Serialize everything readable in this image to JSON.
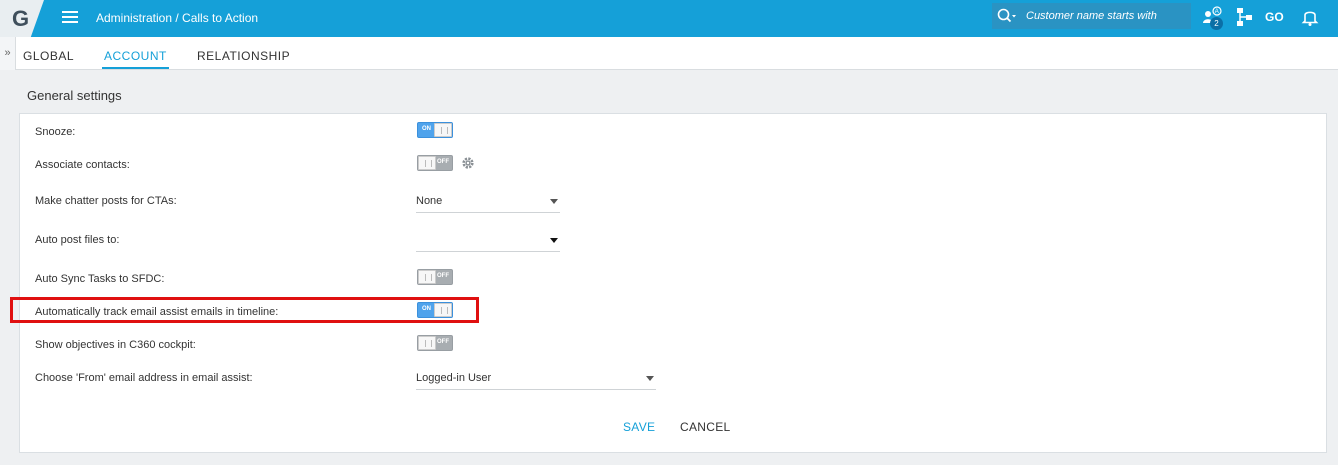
{
  "app": {
    "logo_letter": "G",
    "breadcrumb": "Administration / Calls to Action",
    "search_placeholder": "Customer name starts with",
    "notification_count": "2",
    "go_label": "GO"
  },
  "tabs": [
    {
      "label": "GLOBAL",
      "active": false
    },
    {
      "label": "ACCOUNT",
      "active": true
    },
    {
      "label": "RELATIONSHIP",
      "active": false
    }
  ],
  "section": {
    "title": "General settings"
  },
  "settings": [
    {
      "label": "Snooze:",
      "control": "toggle",
      "state": "ON"
    },
    {
      "label": "Associate contacts:",
      "control": "toggle",
      "state": "OFF"
    },
    {
      "label": "Make chatter posts for CTAs:",
      "control": "select",
      "value": "None"
    },
    {
      "label": "Auto post files to:",
      "control": "select",
      "value": ""
    },
    {
      "label": "Auto Sync Tasks to SFDC:",
      "control": "toggle",
      "state": "OFF"
    },
    {
      "label": "Automatically track email assist emails in timeline:",
      "control": "toggle",
      "state": "ON"
    },
    {
      "label": "Show objectives in C360 cockpit:",
      "control": "toggle",
      "state": "OFF"
    },
    {
      "label": "Choose 'From' email address in email assist:",
      "control": "select",
      "value": "Logged-in User"
    }
  ],
  "actions": {
    "save": "SAVE",
    "cancel": "CANCEL"
  },
  "colors": {
    "accent": "#15a0d8",
    "highlight": "#e01010",
    "toggle_on": "#4fa3ec",
    "toggle_off": "#a8adb1"
  }
}
